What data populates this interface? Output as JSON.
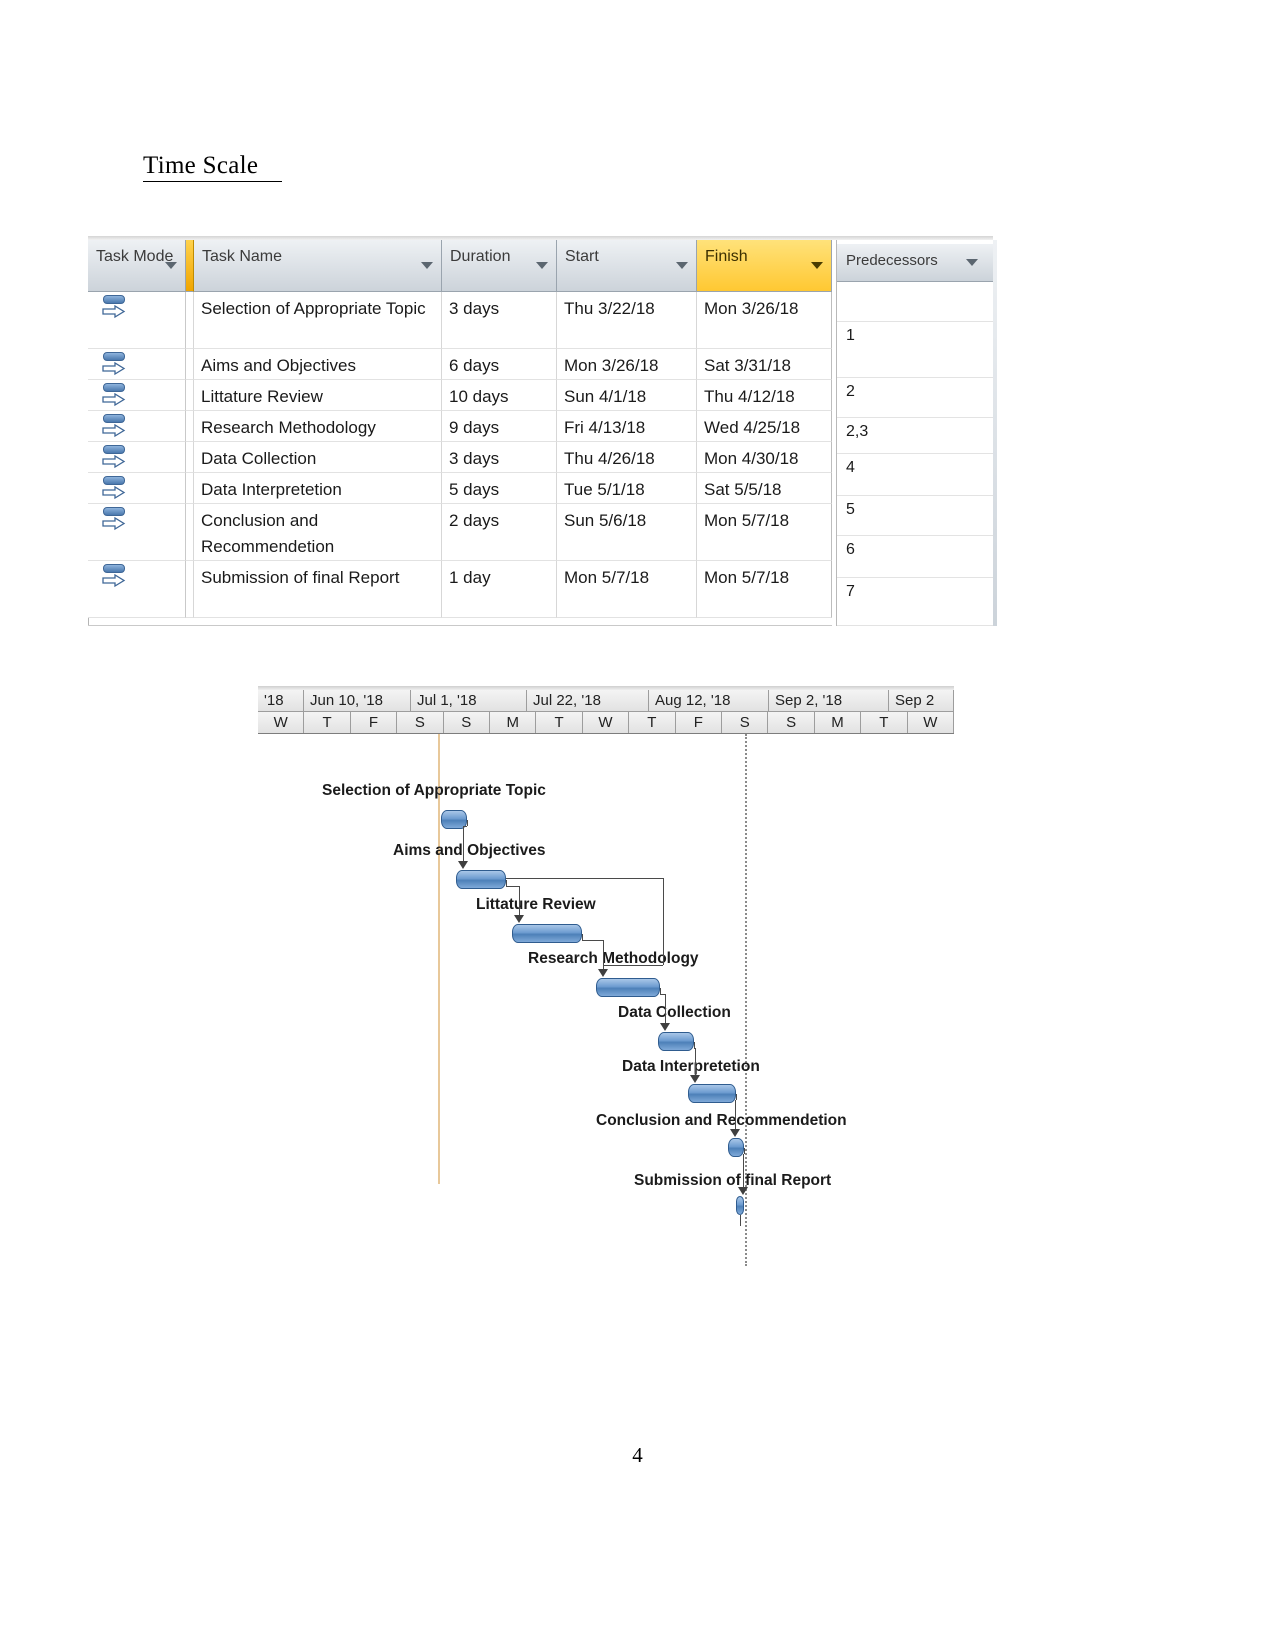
{
  "document": {
    "heading": "Time Scale",
    "page_number": "4"
  },
  "task_table": {
    "columns": [
      {
        "id": "task_mode",
        "label": "Task Mode",
        "has_filter": true
      },
      {
        "id": "task_name",
        "label": "Task Name",
        "has_filter": true
      },
      {
        "id": "duration",
        "label": "Duration",
        "has_filter": true
      },
      {
        "id": "start",
        "label": "Start",
        "has_filter": true
      },
      {
        "id": "finish",
        "label": "Finish",
        "has_filter": true,
        "highlight_color": "#ffc832"
      },
      {
        "id": "predecessors",
        "label": "Predecessors",
        "has_filter": true
      }
    ],
    "rows": [
      {
        "task_name": "Selection of Appropriate Topic",
        "duration": "3 days",
        "start": "Thu 3/22/18",
        "finish": "Mon 3/26/18"
      },
      {
        "task_name": "Aims and Objectives",
        "duration": "6 days",
        "start": "Mon 3/26/18",
        "finish": "Sat 3/31/18"
      },
      {
        "task_name": "Littature Review",
        "duration": "10 days",
        "start": "Sun 4/1/18",
        "finish": "Thu 4/12/18"
      },
      {
        "task_name": "Research Methodology",
        "duration": "9 days",
        "start": "Fri 4/13/18",
        "finish": "Wed 4/25/18"
      },
      {
        "task_name": "Data Collection",
        "duration": "3 days",
        "start": "Thu 4/26/18",
        "finish": "Mon 4/30/18"
      },
      {
        "task_name": "Data Interpretetion",
        "duration": "5 days",
        "start": "Tue 5/1/18",
        "finish": "Sat 5/5/18"
      },
      {
        "task_name": "Conclusion and Recommendetion",
        "duration": "2 days",
        "start": "Sun 5/6/18",
        "finish": "Mon 5/7/18"
      },
      {
        "task_name": "Submission of final Report",
        "duration": "1 day",
        "start": "Mon 5/7/18",
        "finish": "Mon 5/7/18"
      }
    ],
    "predecessors_values": [
      "",
      "1",
      "2",
      "2,3",
      "4",
      "5",
      "6",
      "7"
    ]
  },
  "chart_data": {
    "type": "gantt",
    "title": "Time Scale",
    "timescale": {
      "major_labels": [
        "'18",
        "Jun 10, '18",
        "Jul 1, '18",
        "Jul 22, '18",
        "Aug 12, '18",
        "Sep 2, '18",
        "Sep 2"
      ],
      "minor_labels": [
        "W",
        "T",
        "F",
        "S",
        "S",
        "M",
        "T",
        "W",
        "T",
        "F",
        "S",
        "S",
        "M",
        "T",
        "W"
      ]
    },
    "tasks": [
      {
        "name": "Selection of Appropriate Topic",
        "duration": "3 days",
        "start": "Thu 3/22/18",
        "finish": "Mon 3/26/18",
        "predecessors": ""
      },
      {
        "name": "Aims and Objectives",
        "duration": "6 days",
        "start": "Mon 3/26/18",
        "finish": "Sat 3/31/18",
        "predecessors": "1"
      },
      {
        "name": "Littature Review",
        "duration": "10 days",
        "start": "Sun 4/1/18",
        "finish": "Thu 4/12/18",
        "predecessors": "2"
      },
      {
        "name": "Research Methodology",
        "duration": "9 days",
        "start": "Fri 4/13/18",
        "finish": "Wed 4/25/18",
        "predecessors": "2,3"
      },
      {
        "name": "Data Collection",
        "duration": "3 days",
        "start": "Thu 4/26/18",
        "finish": "Mon 4/30/18",
        "predecessors": "4"
      },
      {
        "name": "Data Interpretetion",
        "duration": "5 days",
        "start": "Tue 5/1/18",
        "finish": "Sat 5/5/18",
        "predecessors": "5"
      },
      {
        "name": "Conclusion and Recommendetion",
        "duration": "2 days",
        "start": "Sun 5/6/18",
        "finish": "Mon 5/7/18",
        "predecessors": "6"
      },
      {
        "name": "Submission of final Report",
        "duration": "1 day",
        "start": "Mon 5/7/18",
        "finish": "Mon 5/7/18",
        "predecessors": "7"
      }
    ],
    "bar_color": "#5b8dc4",
    "bar_border_color": "#2f5c8f",
    "today_line_color": "#e8c89a"
  }
}
